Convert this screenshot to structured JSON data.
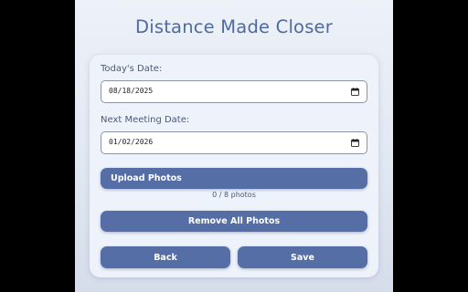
{
  "page": {
    "title": "Distance Made Closer"
  },
  "form": {
    "today_label": "Today's Date:",
    "today_value": "08/18/2025",
    "next_label": "Next Meeting Date:",
    "next_value": "01/02/2026"
  },
  "photos": {
    "upload_label": "Upload Photos",
    "count_text": "0 / 8 photos",
    "remove_label": "Remove All Photos"
  },
  "actions": {
    "back_label": "Back",
    "save_label": "Save"
  },
  "colors": {
    "accent": "#566ea6",
    "title": "#4f6aa0",
    "background": "#e2e8f2"
  },
  "icons": {
    "date_picker": "calendar-icon"
  }
}
